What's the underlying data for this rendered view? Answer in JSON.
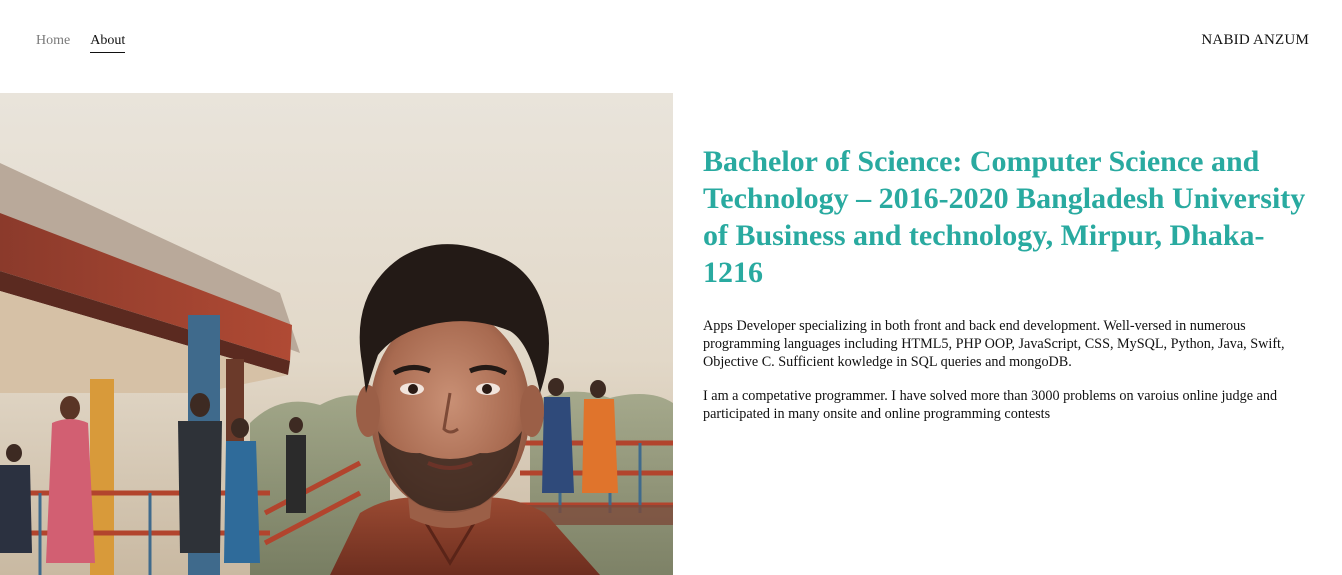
{
  "nav": {
    "items": [
      {
        "label": "Home",
        "active": false
      },
      {
        "label": "About",
        "active": true
      }
    ],
    "brand": "NABID ANZUM"
  },
  "hero_image": {
    "alt": "portrait-photo"
  },
  "main": {
    "headline": "Bachelor of Science: Computer Science and Technology – 2016-2020 Bangladesh University of Business and technology, Mirpur, Dhaka-1216",
    "paragraphs": [
      "Apps Developer specializing in both front and back end development. Well-versed in numerous programming languages including HTML5, PHP OOP, JavaScript, CSS, MySQL, Python, Java, Swift, Objective C. Sufficient kowledge in SQL queries and mongoDB.",
      "I am a competative programmer. I have solved more than 3000 problems on varoius online judge and participated in many onsite and online programming contests"
    ]
  },
  "colors": {
    "accent": "#29aaa0",
    "text": "#111111",
    "nav_inactive": "#7a7a7a"
  }
}
